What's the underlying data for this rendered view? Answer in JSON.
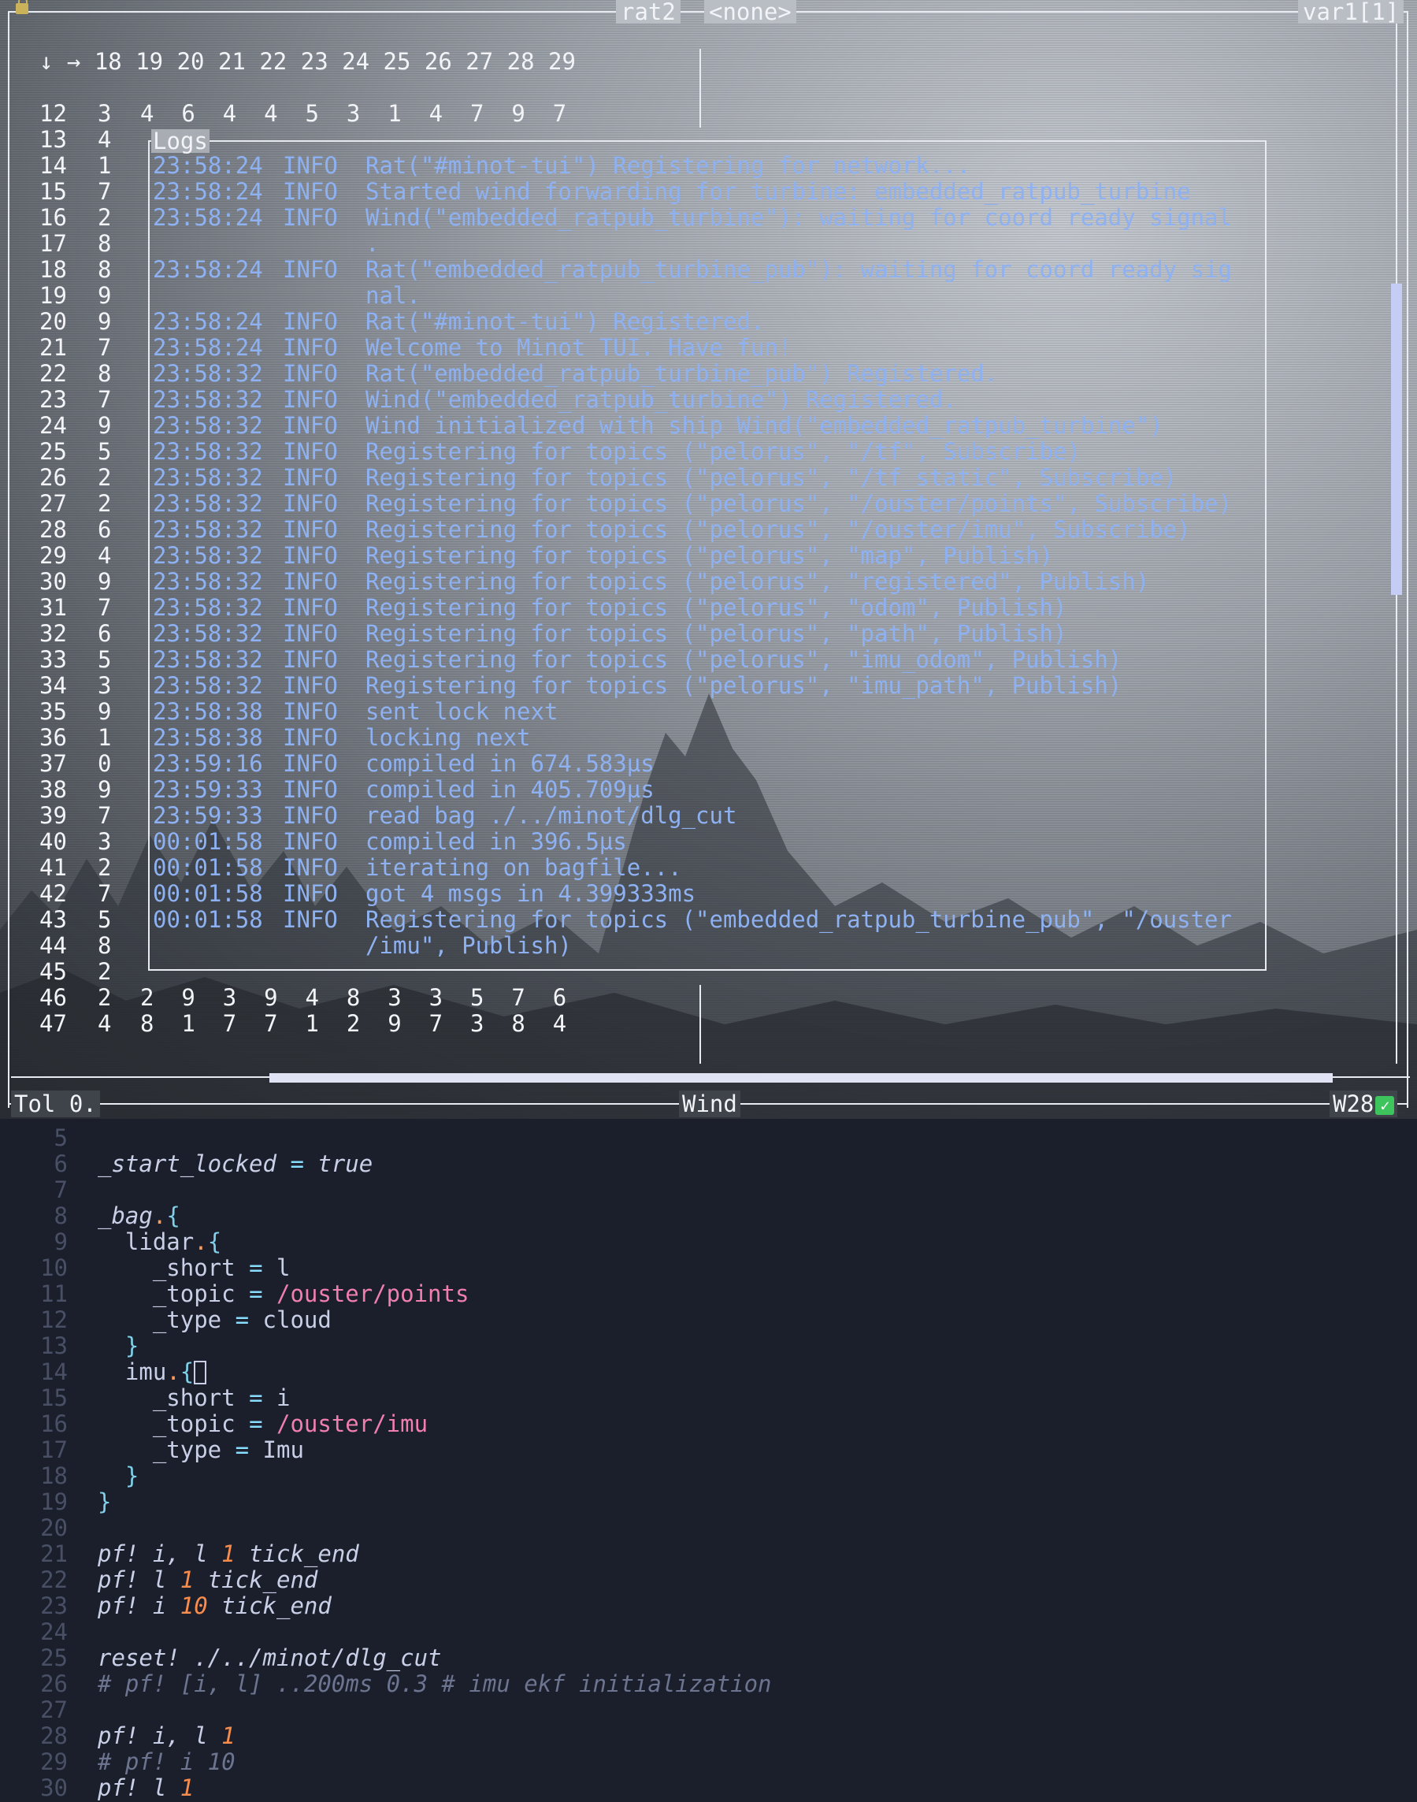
{
  "tui": {
    "left_title": "rat2",
    "center_title": "<none>",
    "right_title": "var1[1]",
    "matrix_header": "↓ → 18 19 20 21 22 23 24 25 26 27 28 29",
    "rows": [
      {
        "label": "12",
        "v": "3",
        "rest": "4  6  4  4  5  3  1  4  7  9  7"
      },
      {
        "label": "13",
        "v": "4"
      },
      {
        "label": "14",
        "v": "1"
      },
      {
        "label": "15",
        "v": "7"
      },
      {
        "label": "16",
        "v": "2"
      },
      {
        "label": "17",
        "v": "8"
      },
      {
        "label": "18",
        "v": "8"
      },
      {
        "label": "19",
        "v": "9"
      },
      {
        "label": "20",
        "v": "9"
      },
      {
        "label": "21",
        "v": "7"
      },
      {
        "label": "22",
        "v": "8"
      },
      {
        "label": "23",
        "v": "7"
      },
      {
        "label": "24",
        "v": "9"
      },
      {
        "label": "25",
        "v": "5"
      },
      {
        "label": "26",
        "v": "2"
      },
      {
        "label": "27",
        "v": "2"
      },
      {
        "label": "28",
        "v": "6"
      },
      {
        "label": "29",
        "v": "4"
      },
      {
        "label": "30",
        "v": "9"
      },
      {
        "label": "31",
        "v": "7"
      },
      {
        "label": "32",
        "v": "6"
      },
      {
        "label": "33",
        "v": "5"
      },
      {
        "label": "34",
        "v": "3"
      },
      {
        "label": "35",
        "v": "9"
      },
      {
        "label": "36",
        "v": "1"
      },
      {
        "label": "37",
        "v": "0"
      },
      {
        "label": "38",
        "v": "9"
      },
      {
        "label": "39",
        "v": "7"
      },
      {
        "label": "40",
        "v": "3"
      },
      {
        "label": "41",
        "v": "2"
      },
      {
        "label": "42",
        "v": "7"
      },
      {
        "label": "43",
        "v": "5"
      },
      {
        "label": "44",
        "v": "8"
      },
      {
        "label": "45",
        "v": "2"
      },
      {
        "label": "46",
        "v": "2",
        "rest": "2  9  3  9  4  8  3  3  5  7  6"
      },
      {
        "label": "47",
        "v": "4",
        "rest": "8  1  7  7  1  2  9  7  3  8  4"
      }
    ],
    "logs_title": "Logs",
    "logs": [
      {
        "ts": "23:58:24",
        "lvl": "INFO",
        "msg": "Rat(\"#minot-tui\") Registering for network..."
      },
      {
        "ts": "23:58:24",
        "lvl": "INFO",
        "msg": "Started wind forwarding for turbine: embedded_ratpub_turbine"
      },
      {
        "ts": "23:58:24",
        "lvl": "INFO",
        "msg": "Wind(\"embedded_ratpub_turbine\"): waiting for coord ready signal"
      },
      {
        "ts": "",
        "lvl": "",
        "msg": "."
      },
      {
        "ts": "23:58:24",
        "lvl": "INFO",
        "msg": "Rat(\"embedded_ratpub_turbine_pub\"): waiting for coord ready sig"
      },
      {
        "ts": "",
        "lvl": "",
        "msg": "nal."
      },
      {
        "ts": "23:58:24",
        "lvl": "INFO",
        "msg": "Rat(\"#minot-tui\") Registered."
      },
      {
        "ts": "23:58:24",
        "lvl": "INFO",
        "msg": "Welcome to Minot TUI. Have fun!"
      },
      {
        "ts": "23:58:32",
        "lvl": "INFO",
        "msg": "Rat(\"embedded_ratpub_turbine_pub\") Registered."
      },
      {
        "ts": "23:58:32",
        "lvl": "INFO",
        "msg": "Wind(\"embedded_ratpub_turbine\") Registered."
      },
      {
        "ts": "23:58:32",
        "lvl": "INFO",
        "msg": "Wind initialized with ship Wind(\"embedded_ratpub_turbine\")"
      },
      {
        "ts": "23:58:32",
        "lvl": "INFO",
        "msg": "Registering for topics (\"pelorus\", \"/tf\", Subscribe)"
      },
      {
        "ts": "23:58:32",
        "lvl": "INFO",
        "msg": "Registering for topics (\"pelorus\", \"/tf_static\", Subscribe)"
      },
      {
        "ts": "23:58:32",
        "lvl": "INFO",
        "msg": "Registering for topics (\"pelorus\", \"/ouster/points\", Subscribe)"
      },
      {
        "ts": "23:58:32",
        "lvl": "INFO",
        "msg": "Registering for topics (\"pelorus\", \"/ouster/imu\", Subscribe)"
      },
      {
        "ts": "23:58:32",
        "lvl": "INFO",
        "msg": "Registering for topics (\"pelorus\", \"map\", Publish)"
      },
      {
        "ts": "23:58:32",
        "lvl": "INFO",
        "msg": "Registering for topics (\"pelorus\", \"registered\", Publish)"
      },
      {
        "ts": "23:58:32",
        "lvl": "INFO",
        "msg": "Registering for topics (\"pelorus\", \"odom\", Publish)"
      },
      {
        "ts": "23:58:32",
        "lvl": "INFO",
        "msg": "Registering for topics (\"pelorus\", \"path\", Publish)"
      },
      {
        "ts": "23:58:32",
        "lvl": "INFO",
        "msg": "Registering for topics (\"pelorus\", \"imu_odom\", Publish)"
      },
      {
        "ts": "23:58:32",
        "lvl": "INFO",
        "msg": "Registering for topics (\"pelorus\", \"imu_path\", Publish)"
      },
      {
        "ts": "23:58:38",
        "lvl": "INFO",
        "msg": "sent lock next"
      },
      {
        "ts": "23:58:38",
        "lvl": "INFO",
        "msg": "locking next"
      },
      {
        "ts": "23:59:16",
        "lvl": "INFO",
        "msg": "compiled in 674.583µs"
      },
      {
        "ts": "23:59:33",
        "lvl": "INFO",
        "msg": "compiled in 405.709µs"
      },
      {
        "ts": "23:59:33",
        "lvl": "INFO",
        "msg": "read bag ./../minot/dlg_cut"
      },
      {
        "ts": "00:01:58",
        "lvl": "INFO",
        "msg": "compiled in 396.5µs"
      },
      {
        "ts": "00:01:58",
        "lvl": "INFO",
        "msg": "iterating on bagfile..."
      },
      {
        "ts": "00:01:58",
        "lvl": "INFO",
        "msg": "got 4 msgs in 4.399333ms"
      },
      {
        "ts": "00:01:58",
        "lvl": "INFO",
        "msg": "Registering for topics (\"embedded_ratpub_turbine_pub\", \"/ouster"
      },
      {
        "ts": "",
        "lvl": "",
        "msg": "/imu\", Publish)"
      }
    ],
    "status_left": "Tol 0.",
    "status_center": "Wind",
    "status_right": "W28",
    "colors": {
      "log": "#8eb1f2",
      "border": "#e8ecf2",
      "scrollbar": "#c6cdf4"
    }
  },
  "editor": {
    "lines": [
      {
        "n": "5",
        "segs": []
      },
      {
        "n": "6",
        "segs": [
          {
            "t": "_start_locked",
            "c": "c-var"
          },
          {
            "t": " = ",
            "c": "c-op"
          },
          {
            "t": "true",
            "c": "c-val"
          }
        ]
      },
      {
        "n": "7",
        "segs": []
      },
      {
        "n": "8",
        "segs": [
          {
            "t": "_bag",
            "c": "c-var"
          },
          {
            "t": ".",
            "c": "c-dot"
          },
          {
            "t": "{",
            "c": "c-brace"
          }
        ]
      },
      {
        "n": "9",
        "segs": [
          {
            "t": "  lidar",
            "c": "c-name"
          },
          {
            "t": ".",
            "c": "c-dot"
          },
          {
            "t": "{",
            "c": "c-brace"
          }
        ]
      },
      {
        "n": "10",
        "segs": [
          {
            "t": "    _short",
            "c": "c-name"
          },
          {
            "t": " = ",
            "c": "c-op"
          },
          {
            "t": "l",
            "c": "c-name"
          }
        ]
      },
      {
        "n": "11",
        "segs": [
          {
            "t": "    _topic",
            "c": "c-name"
          },
          {
            "t": " = ",
            "c": "c-op"
          },
          {
            "t": "/ouster/points",
            "c": "c-path"
          }
        ]
      },
      {
        "n": "12",
        "segs": [
          {
            "t": "    _type",
            "c": "c-name"
          },
          {
            "t": " = ",
            "c": "c-op"
          },
          {
            "t": "cloud",
            "c": "c-name"
          }
        ]
      },
      {
        "n": "13",
        "segs": [
          {
            "t": "  }",
            "c": "c-brace"
          }
        ]
      },
      {
        "n": "14",
        "segs": [
          {
            "t": "  imu",
            "c": "c-name"
          },
          {
            "t": ".",
            "c": "c-dot"
          },
          {
            "t": "{",
            "c": "c-brace"
          },
          {
            "t": "",
            "c": "cursor"
          }
        ]
      },
      {
        "n": "15",
        "segs": [
          {
            "t": "    _short",
            "c": "c-name"
          },
          {
            "t": " = ",
            "c": "c-op"
          },
          {
            "t": "i",
            "c": "c-name"
          }
        ]
      },
      {
        "n": "16",
        "segs": [
          {
            "t": "    _topic",
            "c": "c-name"
          },
          {
            "t": " = ",
            "c": "c-op"
          },
          {
            "t": "/ouster/imu",
            "c": "c-path"
          }
        ]
      },
      {
        "n": "17",
        "segs": [
          {
            "t": "    _type",
            "c": "c-name"
          },
          {
            "t": " = ",
            "c": "c-op"
          },
          {
            "t": "Imu",
            "c": "c-name"
          }
        ]
      },
      {
        "n": "18",
        "segs": [
          {
            "t": "  }",
            "c": "c-brace"
          }
        ]
      },
      {
        "n": "19",
        "segs": [
          {
            "t": "}",
            "c": "c-brace"
          }
        ]
      },
      {
        "n": "20",
        "segs": []
      },
      {
        "n": "21",
        "segs": [
          {
            "t": "pf! i, l ",
            "c": "c-kw"
          },
          {
            "t": "1",
            "c": "c-num"
          },
          {
            "t": " tick_end",
            "c": "c-kw"
          }
        ]
      },
      {
        "n": "22",
        "segs": [
          {
            "t": "pf! l ",
            "c": "c-kw"
          },
          {
            "t": "1",
            "c": "c-num"
          },
          {
            "t": " tick_end",
            "c": "c-kw"
          }
        ]
      },
      {
        "n": "23",
        "segs": [
          {
            "t": "pf! i ",
            "c": "c-kw"
          },
          {
            "t": "10",
            "c": "c-num"
          },
          {
            "t": " tick_end",
            "c": "c-kw"
          }
        ]
      },
      {
        "n": "24",
        "segs": []
      },
      {
        "n": "25",
        "segs": [
          {
            "t": "reset! ./../minot/dlg_cut",
            "c": "c-kw"
          }
        ]
      },
      {
        "n": "26",
        "segs": [
          {
            "t": "# pf! [i, l] ..200ms 0.3 # imu ekf initialization",
            "c": "c-cmt"
          }
        ]
      },
      {
        "n": "27",
        "segs": []
      },
      {
        "n": "28",
        "segs": [
          {
            "t": "pf! i, l ",
            "c": "c-kw"
          },
          {
            "t": "1",
            "c": "c-num"
          }
        ]
      },
      {
        "n": "29",
        "segs": [
          {
            "t": "# pf! i 10",
            "c": "c-cmt"
          }
        ]
      },
      {
        "n": "30",
        "segs": [
          {
            "t": "pf! l ",
            "c": "c-kw"
          },
          {
            "t": "1",
            "c": "c-num"
          }
        ]
      }
    ]
  }
}
